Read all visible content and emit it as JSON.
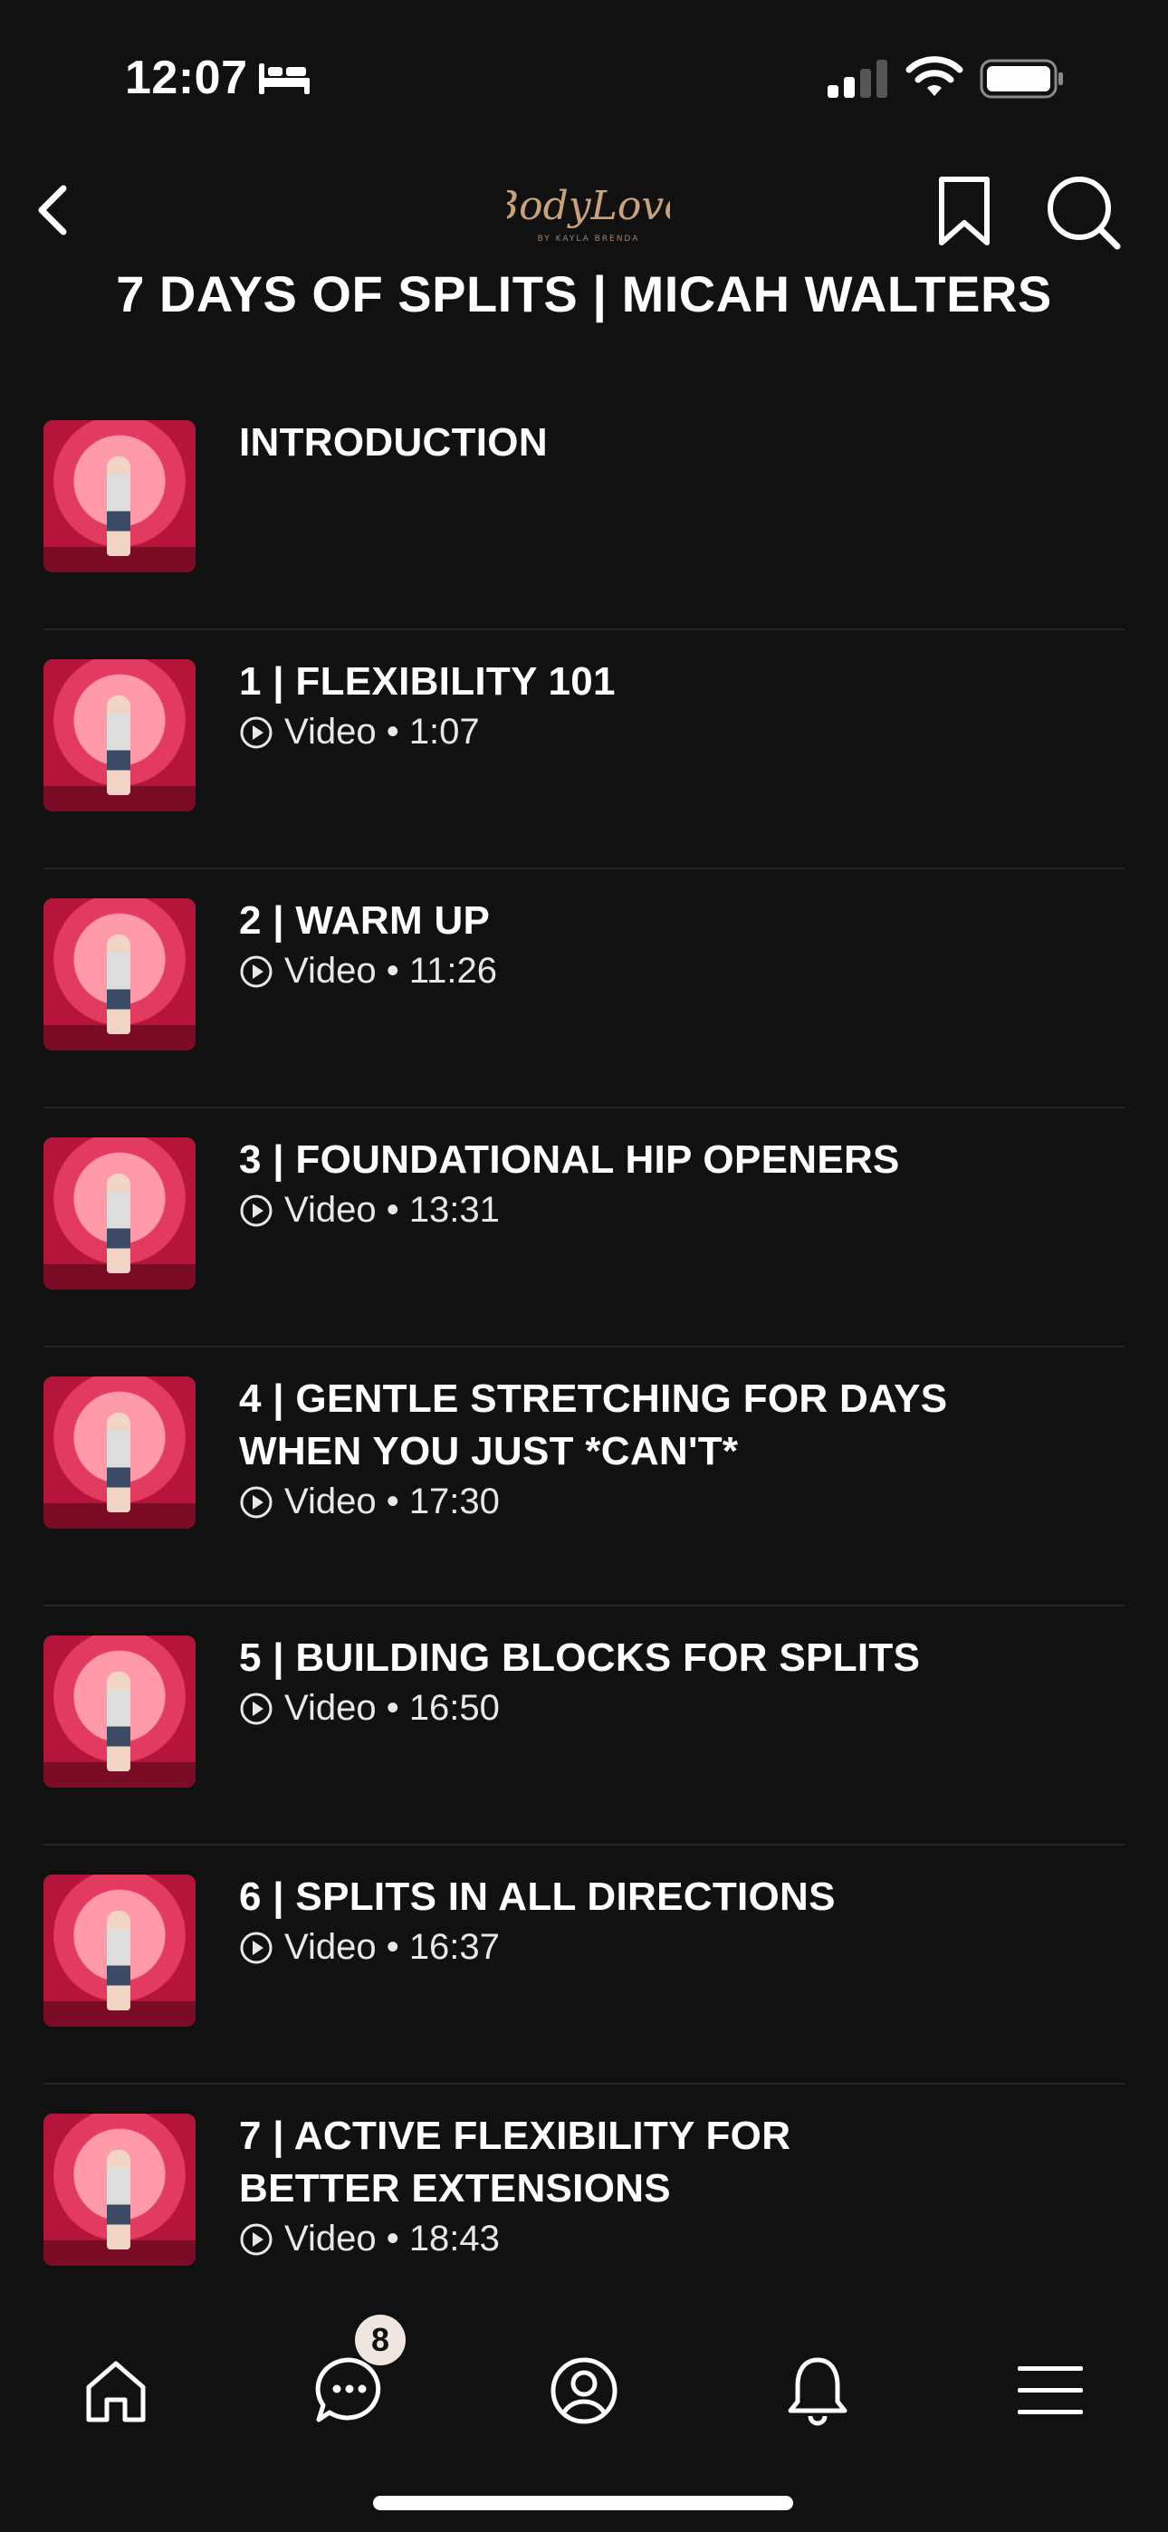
{
  "status_bar": {
    "time": "12:07"
  },
  "header": {
    "logo_text": "BodyLove",
    "logo_subtext": "BY KAYLA BRENDA"
  },
  "page_title": "7 DAYS OF SPLITS | MICAH WALTERS",
  "lessons": [
    {
      "title": "INTRODUCTION",
      "meta": ""
    },
    {
      "title": "1 | FLEXIBILITY 101",
      "meta": "Video • 1:07"
    },
    {
      "title": "2 | WARM UP",
      "meta": "Video • 11:26"
    },
    {
      "title": "3 | FOUNDATIONAL HIP OPENERS",
      "meta": "Video • 13:31"
    },
    {
      "title": "4 | GENTLE STRETCHING FOR DAYS\nWHEN YOU JUST *CAN'T*",
      "meta": "Video • 17:30"
    },
    {
      "title": "5 | BUILDING BLOCKS FOR SPLITS",
      "meta": "Video • 16:50"
    },
    {
      "title": "6 | SPLITS IN ALL DIRECTIONS",
      "meta": "Video • 16:37"
    },
    {
      "title": "7 | ACTIVE FLEXIBILITY FOR\nBETTER EXTENSIONS",
      "meta": "Video • 18:43"
    }
  ],
  "tab_bar": {
    "messages_badge": "8"
  },
  "colors": {
    "background": "#111112",
    "thumb_red": "#e23b5f",
    "logo_gold": "#c9a27a"
  }
}
